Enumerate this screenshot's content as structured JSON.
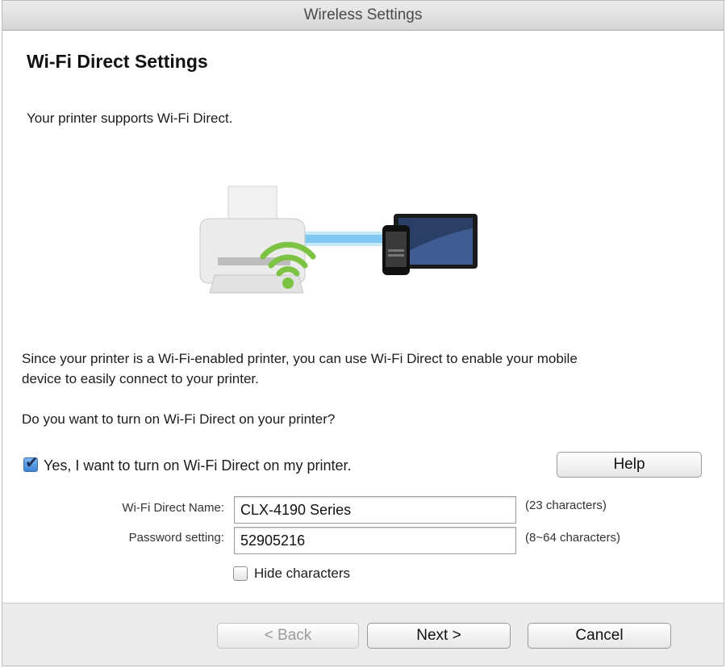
{
  "window": {
    "title": "Wireless Settings"
  },
  "page": {
    "heading": "Wi-Fi Direct Settings",
    "intro": "Your printer supports Wi-Fi Direct.",
    "description_line1": "Since your printer is a Wi-Fi-enabled printer, you can use Wi-Fi Direct to enable your mobile",
    "description_line2": "device to easily connect to your printer.",
    "question": "Do you want to turn on Wi-Fi Direct on your printer?"
  },
  "illustration": {
    "icons": [
      "printer-icon",
      "wifi-icon",
      "smartphone-icon",
      "tablet-icon"
    ],
    "wifi_color": "#7cc243",
    "beam_color": "#7fc8f0"
  },
  "options": {
    "enable_label": "Yes, I want to turn on Wi-Fi Direct on my printer.",
    "enable_checked": true,
    "help_label": "Help",
    "hide_label": "Hide characters",
    "hide_checked": false
  },
  "form": {
    "name_label": "Wi-Fi Direct Name:",
    "name_value": "CLX-4190 Series",
    "name_hint": "(23 characters)",
    "password_label": "Password setting:",
    "password_value": "52905216",
    "password_hint": "(8~64 characters)"
  },
  "footer": {
    "back_label": "< Back",
    "next_label": "Next >",
    "cancel_label": "Cancel"
  }
}
